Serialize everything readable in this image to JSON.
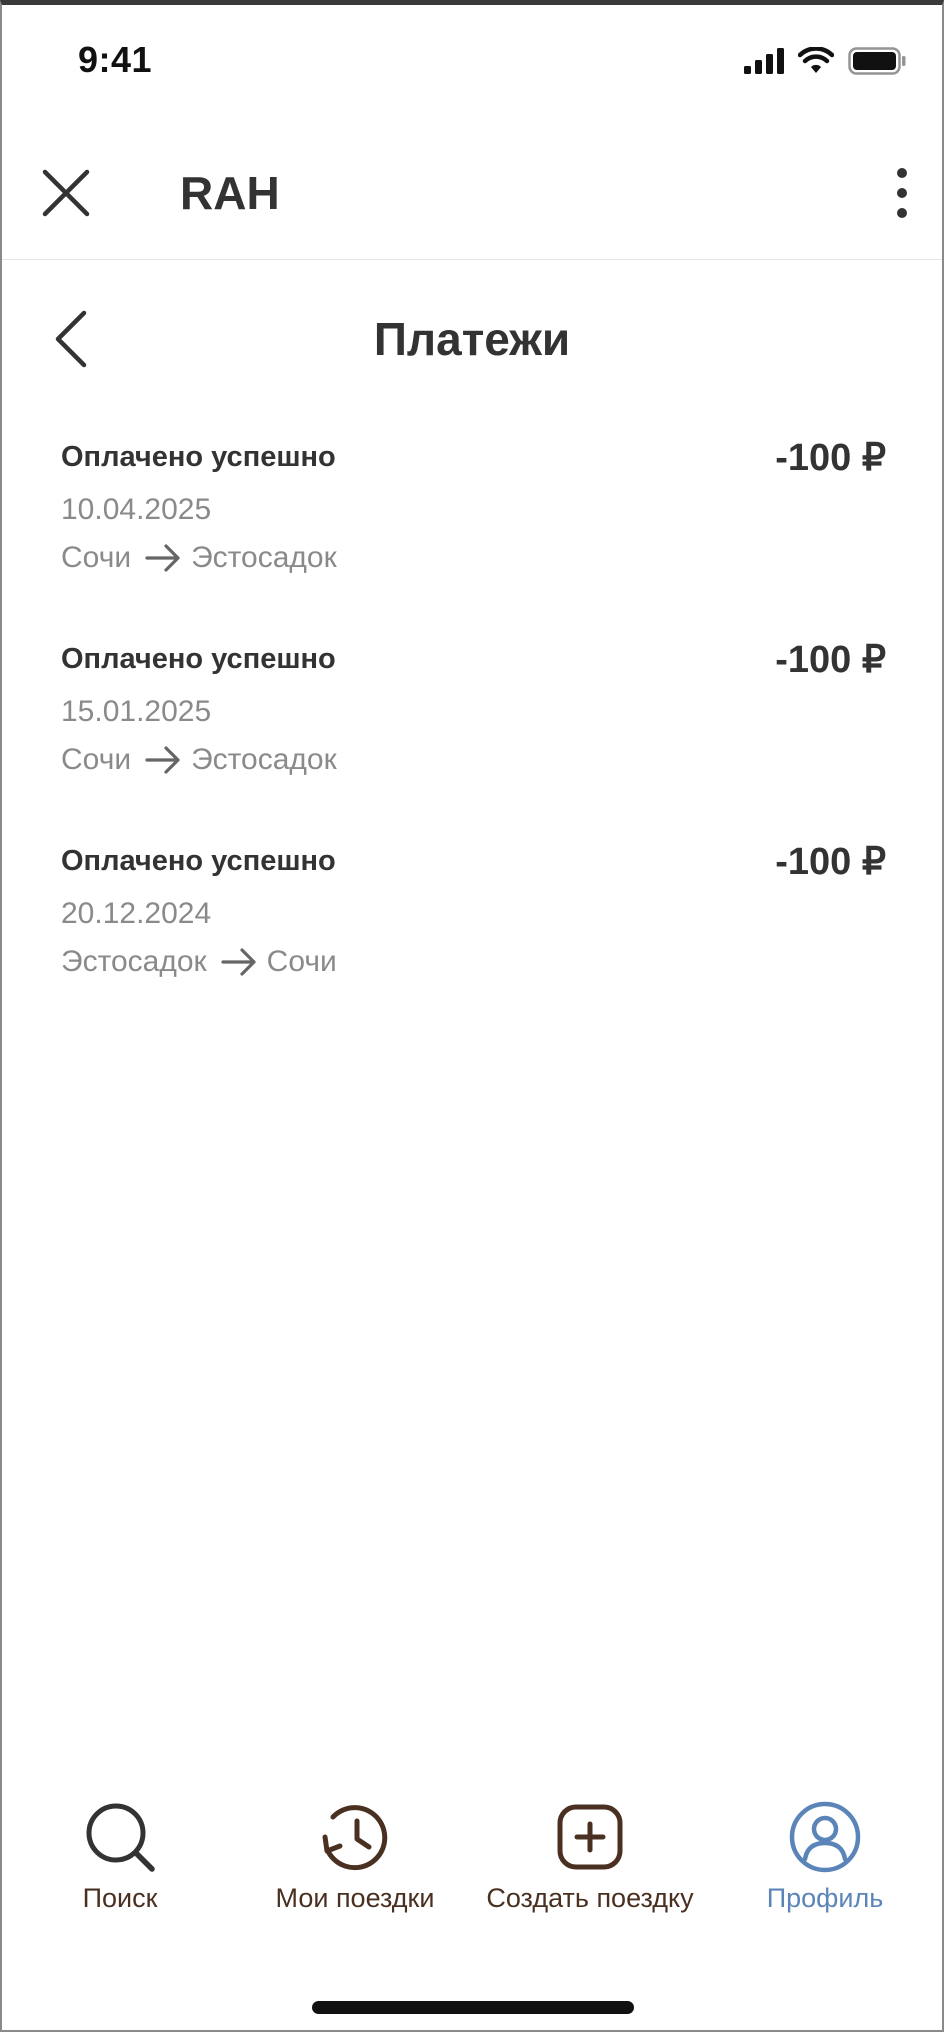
{
  "status_bar": {
    "time": "9:41"
  },
  "header": {
    "title": "RAH"
  },
  "page": {
    "title": "Платежи"
  },
  "payments": [
    {
      "status": "Оплачено успешно",
      "amount": "-100 ₽",
      "date": "10.04.2025",
      "from": "Сочи",
      "to": "Эстосадок"
    },
    {
      "status": "Оплачено успешно",
      "amount": "-100 ₽",
      "date": "15.01.2025",
      "from": "Сочи",
      "to": "Эстосадок"
    },
    {
      "status": "Оплачено успешно",
      "amount": "-100 ₽",
      "date": "20.12.2024",
      "from": "Эстосадок",
      "to": "Сочи"
    }
  ],
  "tab_bar": {
    "items": [
      {
        "label": "Поиск",
        "icon": "search-icon",
        "active": false
      },
      {
        "label": "Мои поездки",
        "icon": "history-icon",
        "active": false
      },
      {
        "label": "Создать поездку",
        "icon": "add-square-icon",
        "active": false
      },
      {
        "label": "Профиль",
        "icon": "profile-icon",
        "active": true
      }
    ]
  },
  "colors": {
    "text_primary": "#333333",
    "text_secondary": "#8a8a8a",
    "tab_inactive": "#4a3020",
    "tab_active": "#5b84b8"
  }
}
